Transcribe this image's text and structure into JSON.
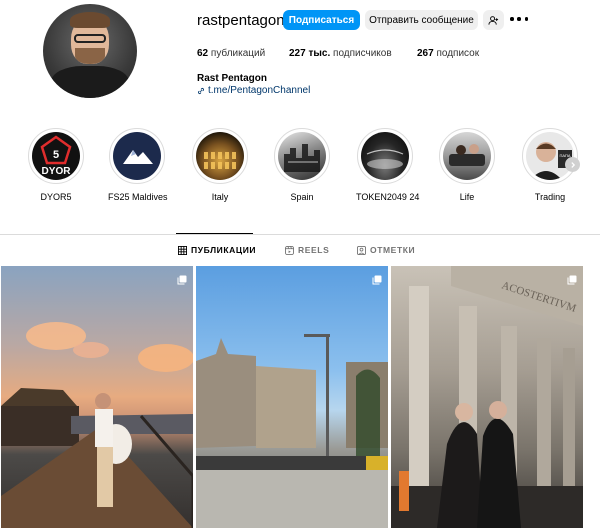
{
  "profile": {
    "username": "rastpentagon",
    "full_name": "Rast Pentagon",
    "link": "t.me/PentagonChannel"
  },
  "actions": {
    "follow_label": "Подписаться",
    "message_label": "Отправить сообщение"
  },
  "stats": {
    "posts_count": "62",
    "posts_label": "публикаций",
    "followers_count": "227 тыс.",
    "followers_label": "подписчиков",
    "following_count": "267",
    "following_label": "подписок"
  },
  "highlights": [
    {
      "label": "DYOR5",
      "icon": "dyor-logo"
    },
    {
      "label": "FS25 Maldives",
      "icon": "mountain-logo"
    },
    {
      "label": "Italy",
      "icon": "colosseum-photo"
    },
    {
      "label": "Spain",
      "icon": "city-photo"
    },
    {
      "label": "TOKEN2049 24",
      "icon": "event-photo"
    },
    {
      "label": "Life",
      "icon": "people-photo"
    },
    {
      "label": "Trading",
      "icon": "portrait-photo"
    }
  ],
  "tabs": [
    {
      "label": "ПУБЛИКАЦИИ",
      "icon": "grid-icon",
      "active": true
    },
    {
      "label": "REELS",
      "icon": "reels-icon",
      "active": false
    },
    {
      "label": "ОТМЕТКИ",
      "icon": "tag-icon",
      "active": false
    }
  ],
  "posts": [
    {
      "type": "carousel",
      "description_icon": "multi-image-icon"
    },
    {
      "type": "carousel",
      "description_icon": "multi-image-icon"
    },
    {
      "type": "carousel",
      "description_icon": "multi-image-icon"
    }
  ],
  "colors": {
    "accent": "#0095f6",
    "secondary_button": "#efefef",
    "link": "#00376b",
    "border": "#dbdbdb"
  }
}
